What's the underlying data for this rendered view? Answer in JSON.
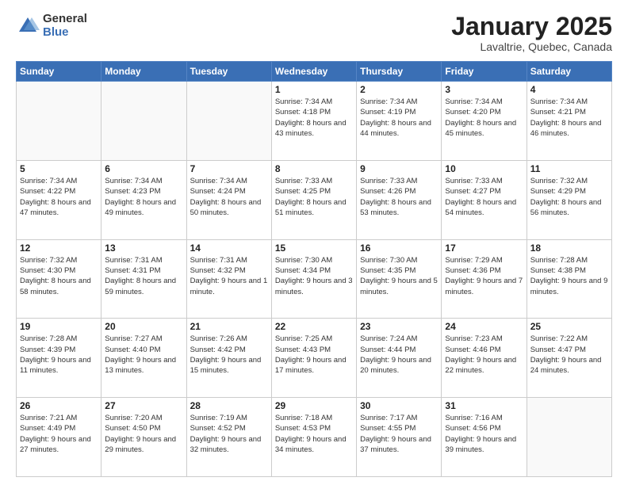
{
  "header": {
    "logo_general": "General",
    "logo_blue": "Blue",
    "month_title": "January 2025",
    "location": "Lavaltrie, Quebec, Canada"
  },
  "calendar": {
    "days_of_week": [
      "Sunday",
      "Monday",
      "Tuesday",
      "Wednesday",
      "Thursday",
      "Friday",
      "Saturday"
    ],
    "weeks": [
      [
        {
          "day": "",
          "info": ""
        },
        {
          "day": "",
          "info": ""
        },
        {
          "day": "",
          "info": ""
        },
        {
          "day": "1",
          "info": "Sunrise: 7:34 AM\nSunset: 4:18 PM\nDaylight: 8 hours\nand 43 minutes."
        },
        {
          "day": "2",
          "info": "Sunrise: 7:34 AM\nSunset: 4:19 PM\nDaylight: 8 hours\nand 44 minutes."
        },
        {
          "day": "3",
          "info": "Sunrise: 7:34 AM\nSunset: 4:20 PM\nDaylight: 8 hours\nand 45 minutes."
        },
        {
          "day": "4",
          "info": "Sunrise: 7:34 AM\nSunset: 4:21 PM\nDaylight: 8 hours\nand 46 minutes."
        }
      ],
      [
        {
          "day": "5",
          "info": "Sunrise: 7:34 AM\nSunset: 4:22 PM\nDaylight: 8 hours\nand 47 minutes."
        },
        {
          "day": "6",
          "info": "Sunrise: 7:34 AM\nSunset: 4:23 PM\nDaylight: 8 hours\nand 49 minutes."
        },
        {
          "day": "7",
          "info": "Sunrise: 7:34 AM\nSunset: 4:24 PM\nDaylight: 8 hours\nand 50 minutes."
        },
        {
          "day": "8",
          "info": "Sunrise: 7:33 AM\nSunset: 4:25 PM\nDaylight: 8 hours\nand 51 minutes."
        },
        {
          "day": "9",
          "info": "Sunrise: 7:33 AM\nSunset: 4:26 PM\nDaylight: 8 hours\nand 53 minutes."
        },
        {
          "day": "10",
          "info": "Sunrise: 7:33 AM\nSunset: 4:27 PM\nDaylight: 8 hours\nand 54 minutes."
        },
        {
          "day": "11",
          "info": "Sunrise: 7:32 AM\nSunset: 4:29 PM\nDaylight: 8 hours\nand 56 minutes."
        }
      ],
      [
        {
          "day": "12",
          "info": "Sunrise: 7:32 AM\nSunset: 4:30 PM\nDaylight: 8 hours\nand 58 minutes."
        },
        {
          "day": "13",
          "info": "Sunrise: 7:31 AM\nSunset: 4:31 PM\nDaylight: 8 hours\nand 59 minutes."
        },
        {
          "day": "14",
          "info": "Sunrise: 7:31 AM\nSunset: 4:32 PM\nDaylight: 9 hours\nand 1 minute."
        },
        {
          "day": "15",
          "info": "Sunrise: 7:30 AM\nSunset: 4:34 PM\nDaylight: 9 hours\nand 3 minutes."
        },
        {
          "day": "16",
          "info": "Sunrise: 7:30 AM\nSunset: 4:35 PM\nDaylight: 9 hours\nand 5 minutes."
        },
        {
          "day": "17",
          "info": "Sunrise: 7:29 AM\nSunset: 4:36 PM\nDaylight: 9 hours\nand 7 minutes."
        },
        {
          "day": "18",
          "info": "Sunrise: 7:28 AM\nSunset: 4:38 PM\nDaylight: 9 hours\nand 9 minutes."
        }
      ],
      [
        {
          "day": "19",
          "info": "Sunrise: 7:28 AM\nSunset: 4:39 PM\nDaylight: 9 hours\nand 11 minutes."
        },
        {
          "day": "20",
          "info": "Sunrise: 7:27 AM\nSunset: 4:40 PM\nDaylight: 9 hours\nand 13 minutes."
        },
        {
          "day": "21",
          "info": "Sunrise: 7:26 AM\nSunset: 4:42 PM\nDaylight: 9 hours\nand 15 minutes."
        },
        {
          "day": "22",
          "info": "Sunrise: 7:25 AM\nSunset: 4:43 PM\nDaylight: 9 hours\nand 17 minutes."
        },
        {
          "day": "23",
          "info": "Sunrise: 7:24 AM\nSunset: 4:44 PM\nDaylight: 9 hours\nand 20 minutes."
        },
        {
          "day": "24",
          "info": "Sunrise: 7:23 AM\nSunset: 4:46 PM\nDaylight: 9 hours\nand 22 minutes."
        },
        {
          "day": "25",
          "info": "Sunrise: 7:22 AM\nSunset: 4:47 PM\nDaylight: 9 hours\nand 24 minutes."
        }
      ],
      [
        {
          "day": "26",
          "info": "Sunrise: 7:21 AM\nSunset: 4:49 PM\nDaylight: 9 hours\nand 27 minutes."
        },
        {
          "day": "27",
          "info": "Sunrise: 7:20 AM\nSunset: 4:50 PM\nDaylight: 9 hours\nand 29 minutes."
        },
        {
          "day": "28",
          "info": "Sunrise: 7:19 AM\nSunset: 4:52 PM\nDaylight: 9 hours\nand 32 minutes."
        },
        {
          "day": "29",
          "info": "Sunrise: 7:18 AM\nSunset: 4:53 PM\nDaylight: 9 hours\nand 34 minutes."
        },
        {
          "day": "30",
          "info": "Sunrise: 7:17 AM\nSunset: 4:55 PM\nDaylight: 9 hours\nand 37 minutes."
        },
        {
          "day": "31",
          "info": "Sunrise: 7:16 AM\nSunset: 4:56 PM\nDaylight: 9 hours\nand 39 minutes."
        },
        {
          "day": "",
          "info": ""
        }
      ]
    ]
  }
}
